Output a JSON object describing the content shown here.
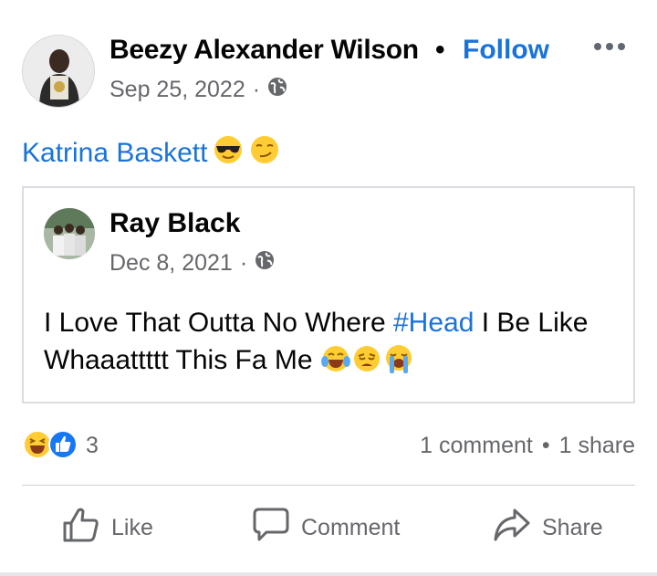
{
  "post": {
    "author": "Beezy Alexander Wilson",
    "separator": "•",
    "follow_label": "Follow",
    "date": "Sep 25, 2022",
    "meta_sep": "·",
    "audience_icon": "globe-icon",
    "tagged_name": "Katrina Baskett",
    "tag_emojis": [
      "sunglasses-face",
      "smirking-face"
    ]
  },
  "shared_post": {
    "author": "Ray Black",
    "date": "Dec 8, 2021",
    "meta_sep": "·",
    "audience_icon": "globe-icon",
    "text_before": "I Love That Outta No Where ",
    "hashtag": "#Head",
    "text_after": " I Be Like Whaaattttt This Fa Me",
    "text_emojis": [
      "tears-of-joy-face",
      "weary-face",
      "loudly-crying-face"
    ]
  },
  "engagement": {
    "reaction_icons": [
      "haha-reaction-icon",
      "like-reaction-icon"
    ],
    "reaction_count": "3",
    "comments": "1 comment",
    "stats_sep": "•",
    "shares": "1 share"
  },
  "actions": {
    "like": "Like",
    "comment": "Comment",
    "share": "Share"
  },
  "colors": {
    "link": "#1a73d9",
    "secondary_text": "#65676b",
    "divider": "#ced0d4"
  }
}
